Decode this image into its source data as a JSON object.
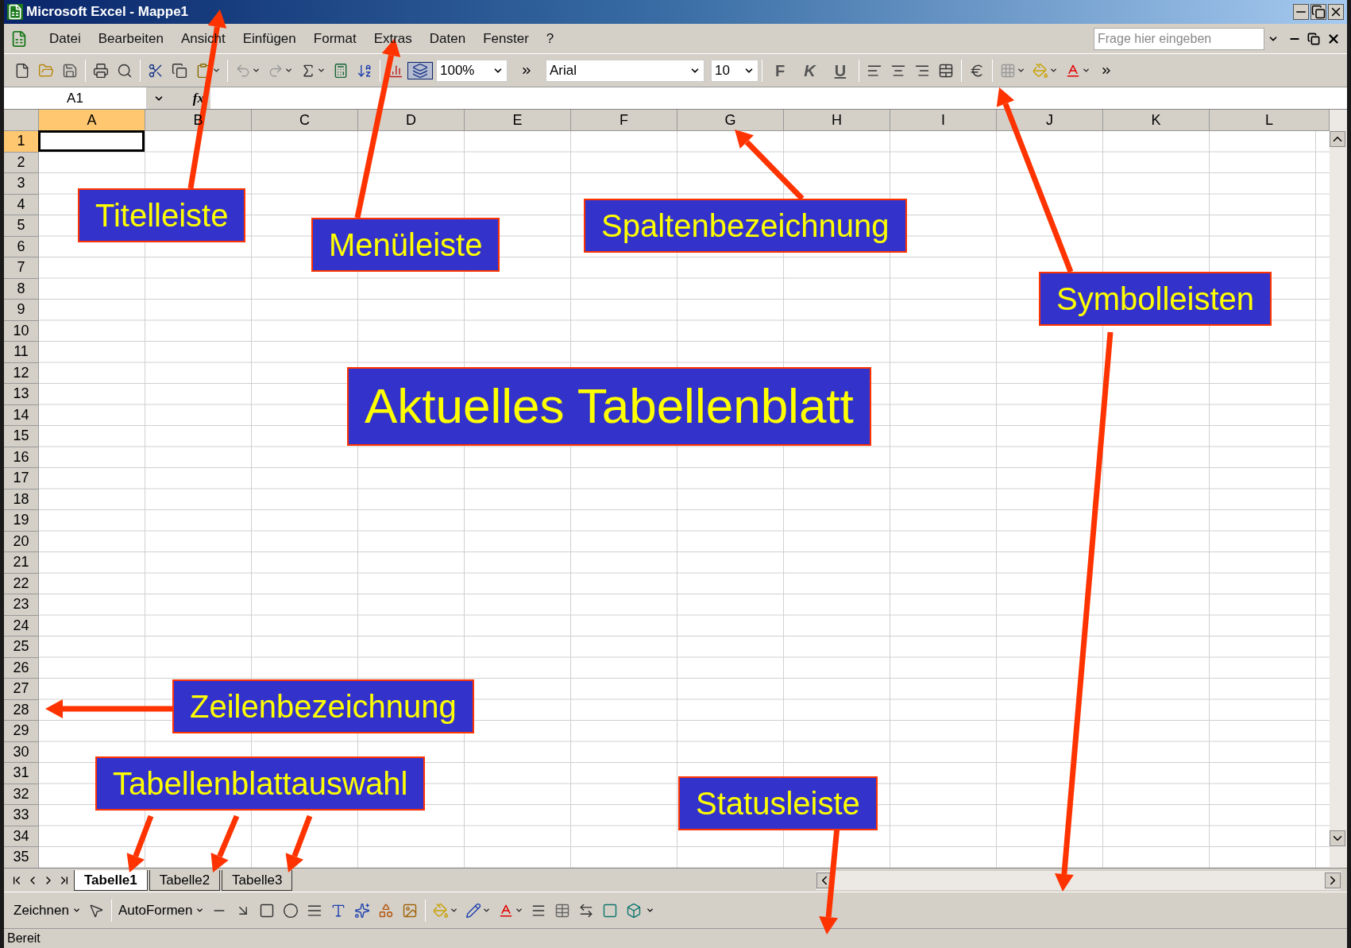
{
  "window": {
    "title": "Microsoft Excel - Mappe1"
  },
  "menu": {
    "items": [
      "Datei",
      "Bearbeiten",
      "Ansicht",
      "Einfügen",
      "Format",
      "Extras",
      "Daten",
      "Fenster",
      "?"
    ],
    "help_search": {
      "placeholder": "Frage hier eingeben"
    }
  },
  "toolbar": {
    "zoom": "100%",
    "font": "Arial",
    "font_size": "10",
    "bold": "F",
    "italic": "K",
    "underline": "U"
  },
  "formula_bar": {
    "name_box": "A1",
    "function_label": "fx"
  },
  "sheet": {
    "columns": [
      {
        "label": "A",
        "selected": true
      },
      {
        "label": "B",
        "selected": false
      },
      {
        "label": "C",
        "selected": false
      },
      {
        "label": "D",
        "selected": false
      },
      {
        "label": "E",
        "selected": false
      },
      {
        "label": "F",
        "selected": false
      },
      {
        "label": "G",
        "selected": false
      },
      {
        "label": "H",
        "selected": false
      },
      {
        "label": "I",
        "selected": false
      },
      {
        "label": "J",
        "selected": false
      },
      {
        "label": "K",
        "selected": false
      },
      {
        "label": "L",
        "selected": false
      }
    ],
    "rows": [
      {
        "label": "1",
        "selected": true
      },
      {
        "label": "2",
        "selected": false
      },
      {
        "label": "3",
        "selected": false
      },
      {
        "label": "4",
        "selected": false
      },
      {
        "label": "5",
        "selected": false
      },
      {
        "label": "6",
        "selected": false
      },
      {
        "label": "7",
        "selected": false
      },
      {
        "label": "8",
        "selected": false
      },
      {
        "label": "9",
        "selected": false
      },
      {
        "label": "10",
        "selected": false
      },
      {
        "label": "11",
        "selected": false
      },
      {
        "label": "12",
        "selected": false
      },
      {
        "label": "13",
        "selected": false
      },
      {
        "label": "14",
        "selected": false
      },
      {
        "label": "15",
        "selected": false
      },
      {
        "label": "16",
        "selected": false
      },
      {
        "label": "17",
        "selected": false
      },
      {
        "label": "18",
        "selected": false
      },
      {
        "label": "19",
        "selected": false
      },
      {
        "label": "20",
        "selected": false
      },
      {
        "label": "21",
        "selected": false
      },
      {
        "label": "22",
        "selected": false
      },
      {
        "label": "23",
        "selected": false
      },
      {
        "label": "24",
        "selected": false
      },
      {
        "label": "25",
        "selected": false
      },
      {
        "label": "26",
        "selected": false
      },
      {
        "label": "27",
        "selected": false
      },
      {
        "label": "28",
        "selected": false
      },
      {
        "label": "29",
        "selected": false
      },
      {
        "label": "30",
        "selected": false
      },
      {
        "label": "31",
        "selected": false
      },
      {
        "label": "32",
        "selected": false
      },
      {
        "label": "33",
        "selected": false
      },
      {
        "label": "34",
        "selected": false
      },
      {
        "label": "35",
        "selected": false
      }
    ]
  },
  "sheet_tabs": [
    {
      "label": "Tabelle1",
      "selected": true
    },
    {
      "label": "Tabelle2",
      "selected": false
    },
    {
      "label": "Tabelle3",
      "selected": false
    }
  ],
  "drawing_toolbar": {
    "menu": "Zeichnen",
    "autoshapes": "AutoFormen"
  },
  "status_bar": {
    "text": "Bereit"
  },
  "annotations": [
    {
      "label": "Titelleiste"
    },
    {
      "label": "Menüleiste"
    },
    {
      "label": "Spaltenbezeichnung"
    },
    {
      "label": "Symbolleisten"
    },
    {
      "label": "Aktuelles Tabellenblatt"
    },
    {
      "label": "Zeilenbezeichnung"
    },
    {
      "label": "Tabellenblattauswahl"
    },
    {
      "label": "Statusleiste"
    }
  ]
}
